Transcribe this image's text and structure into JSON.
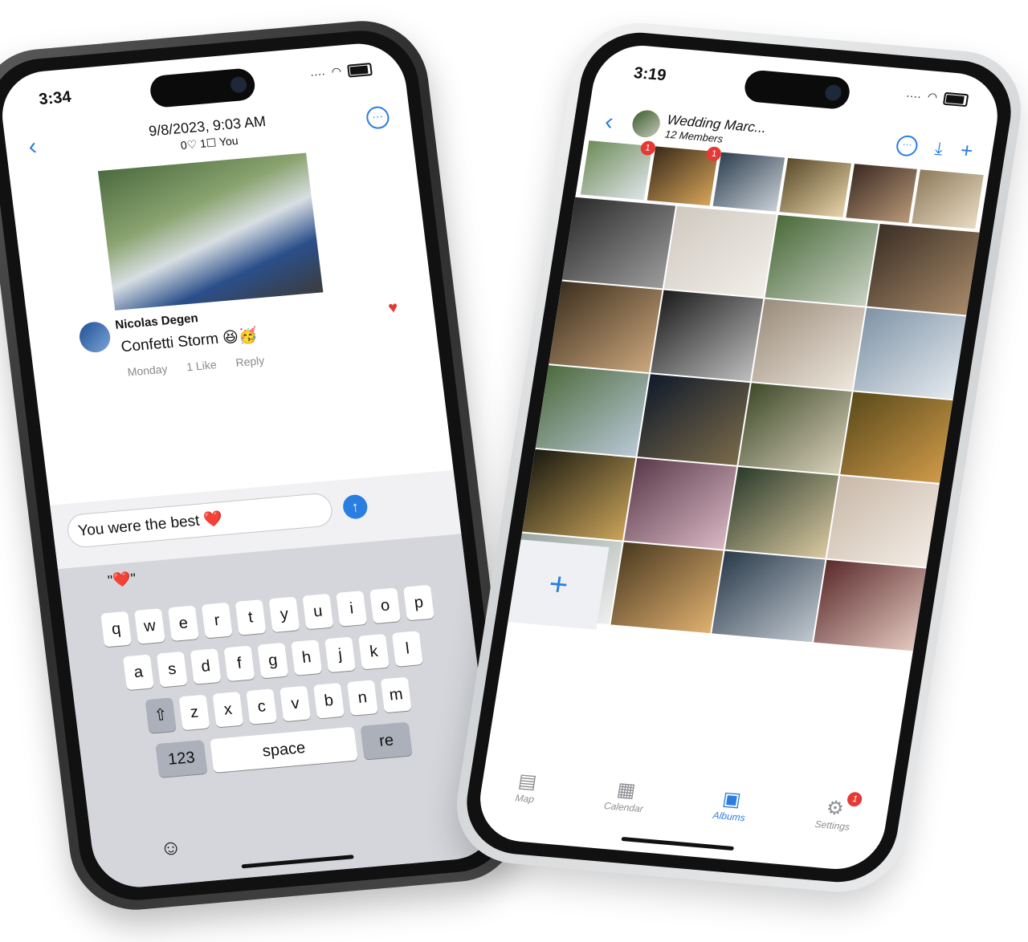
{
  "left_phone": {
    "status": {
      "time": "3:34"
    },
    "header": {
      "date": "9/8/2023, 9:03 AM",
      "counts": "0♡ 1☐ You"
    },
    "comment": {
      "author": "Nicolas Degen",
      "text": "Confetti Storm 😆🥳",
      "time": "Monday",
      "likes": "1 Like",
      "reply": "Reply"
    },
    "composer": {
      "value": "You were the best ❤️"
    },
    "keyboard": {
      "suggestion": "\"❤️\"",
      "row1": [
        "q",
        "w",
        "e",
        "r",
        "t",
        "y",
        "u",
        "i",
        "o",
        "p"
      ],
      "row2": [
        "a",
        "s",
        "d",
        "f",
        "g",
        "h",
        "j",
        "k",
        "l"
      ],
      "row3": [
        "z",
        "x",
        "c",
        "v",
        "b",
        "n",
        "m"
      ],
      "numbers": "123",
      "space": "space",
      "return": "re"
    }
  },
  "right_phone": {
    "status": {
      "time": "3:19"
    },
    "album": {
      "title": "Wedding Marc...",
      "members": "12 Members"
    },
    "strip_badges": [
      "1",
      "1"
    ],
    "tabs": [
      {
        "label": "Map",
        "icon": "map-icon"
      },
      {
        "label": "Calendar",
        "icon": "calendar-icon"
      },
      {
        "label": "Albums",
        "icon": "albums-icon"
      },
      {
        "label": "Settings",
        "icon": "settings-icon",
        "badge": "1"
      }
    ],
    "colors": {
      "accent": "#2a7de1",
      "badge": "#e53935"
    }
  }
}
